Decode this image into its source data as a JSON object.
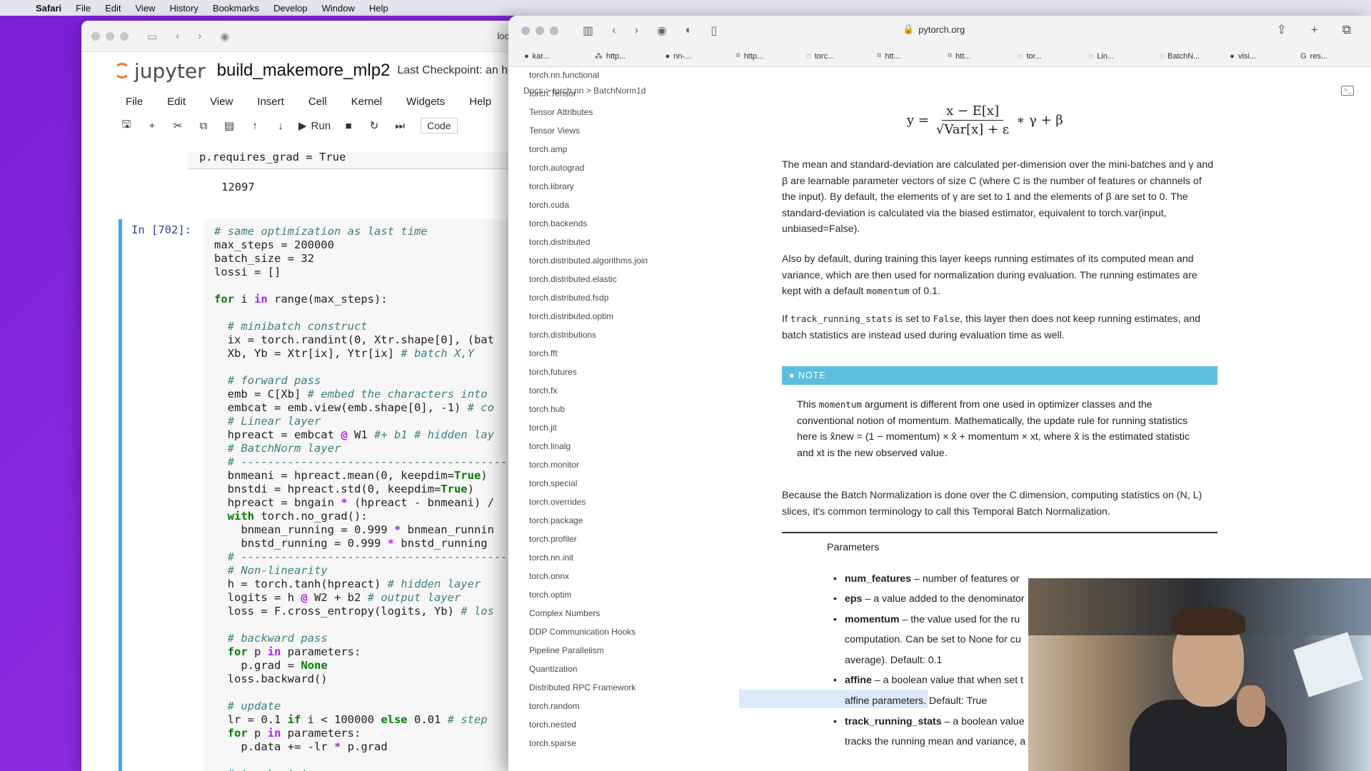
{
  "menubar": {
    "items": [
      "Safari",
      "File",
      "Edit",
      "View",
      "History",
      "Bookmarks",
      "Develop",
      "Window",
      "Help"
    ]
  },
  "jupyter": {
    "address": "locall",
    "logo_text": "jupyter",
    "notebook_name": "build_makemore_mlp2",
    "checkpoint": "Last Checkpoint: an hour a",
    "menu": [
      "File",
      "Edit",
      "View",
      "Insert",
      "Cell",
      "Kernel",
      "Widgets",
      "Help"
    ],
    "toolbar": {
      "run_label": "Run",
      "cell_type": "Code"
    },
    "prev_cell_code": "p.requires_grad = True",
    "prev_output": "12097",
    "cell_prompt": "In [702]:"
  },
  "safari": {
    "url": "pytorch.org",
    "favorites": [
      "kar...",
      "http...",
      "nn-...",
      "http...",
      "torc...",
      "htt...",
      "htt...",
      "tor...",
      "Lin...",
      "BatchN...",
      "visi...",
      "res..."
    ],
    "nav_links": [
      "torch.nn.functional",
      "torch.Tensor",
      "Tensor Attributes",
      "Tensor Views",
      "torch.amp",
      "torch.autograd",
      "torch.library",
      "torch.cuda",
      "torch.backends",
      "torch.distributed",
      "torch.distributed.algorithms.join",
      "torch.distributed.elastic",
      "torch.distributed.fsdp",
      "torch.distributed.optim",
      "torch.distributions",
      "torch.fft",
      "torch.futures",
      "torch.fx",
      "torch.hub",
      "torch.jit",
      "torch.linalg",
      "torch.monitor",
      "torch.special",
      "torch.overrides",
      "torch.package",
      "torch.profiler",
      "torch.nn.init",
      "torch.onnx",
      "torch.optim",
      "Complex Numbers",
      "DDP Communication Hooks",
      "Pipeline Parallelism",
      "Quantization",
      "Distributed RPC Framework",
      "torch.random",
      "torch.nested",
      "torch.sparse"
    ],
    "breadcrumb": [
      "Docs",
      ">",
      "torch.nn",
      ">",
      "BatchNorm1d"
    ],
    "formula": {
      "lhs": "y =",
      "numerator": "x − E[x]",
      "denominator": "√Var[x] + ε",
      "rhs": "∗ γ + β"
    },
    "para1": "The mean and standard-deviation are calculated per-dimension over the mini-batches and γ and β are learnable parameter vectors of size C (where C is the number of features or channels of the input). By default, the elements of γ are set to 1 and the elements of β are set to 0. The standard-deviation is calculated via the biased estimator, equivalent to torch.var(input, unbiased=False).",
    "para2_a": "Also by default, during training this layer keeps running estimates of its computed mean and variance, which are then used for normalization during evaluation. The running estimates are kept with a default ",
    "para2_code": "momentum",
    "para2_b": " of 0.1.",
    "para3_a": "If ",
    "para3_code1": "track_running_stats",
    "para3_b": " is set to ",
    "para3_code2": "False",
    "para3_c": ", this layer then does not keep running estimates, and batch statistics are instead used during evaluation time as well.",
    "note_label": "NOTE",
    "note_a": "This ",
    "note_code": "momentum",
    "note_b": " argument is different from one used in optimizer classes and the conventional notion of momentum. Mathematically, the update rule for running statistics here is x̂new = (1 − momentum) × x̂ + momentum × xt, where x̂ is the estimated statistic and xt is the new observed value.",
    "para4": "Because the Batch Normalization is done over the C dimension, computing statistics on (N, L) slices, it's common terminology to call this Temporal Batch Normalization.",
    "params_heading": "Parameters",
    "params": [
      {
        "name": "num_features",
        "desc": " – number of features or"
      },
      {
        "name": "eps",
        "desc": " – a value added to the denominator"
      },
      {
        "name": "momentum",
        "desc": " – the value used for the ru"
      },
      {
        "name": "",
        "desc": "computation. Can be set to None for cu"
      },
      {
        "name": "",
        "desc": "average). Default: 0.1"
      },
      {
        "name": "affine",
        "desc": " – a boolean value that when set t"
      },
      {
        "name": "",
        "desc": "affine parameters. Default:  True"
      },
      {
        "name": "track_running_stats",
        "desc": " – a boolean value"
      },
      {
        "name": "",
        "desc": "tracks the running mean and variance, a"
      }
    ]
  }
}
